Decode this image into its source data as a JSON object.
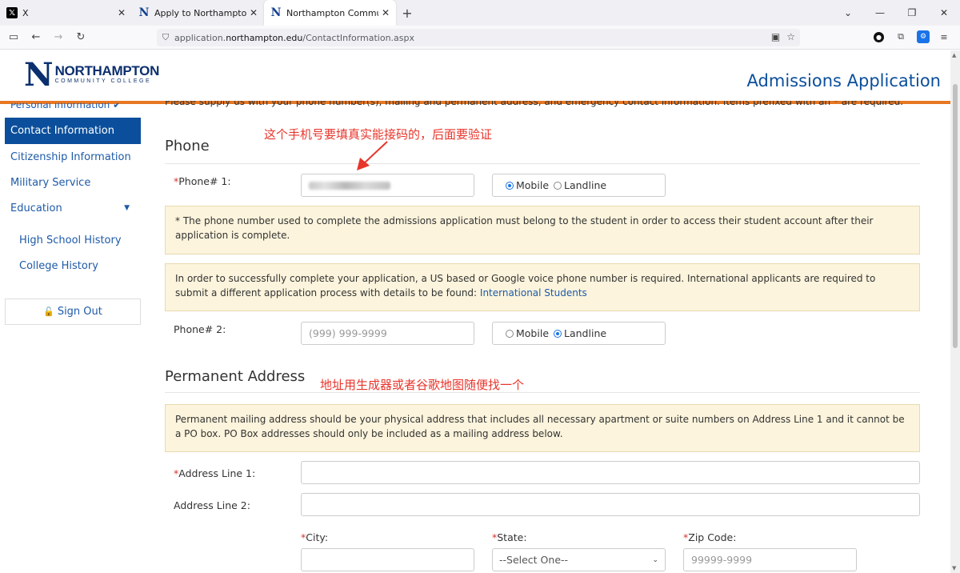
{
  "browser": {
    "tabs": [
      {
        "title": "X",
        "favicon": "x-logo"
      },
      {
        "title": "Apply to Northampton Community College",
        "favicon": "n-logo"
      },
      {
        "title": "Northampton Community College",
        "favicon": "n-logo"
      }
    ],
    "url_prefix": "application.",
    "url_domain": "northampton.edu",
    "url_path": "/ContactInformation.aspx"
  },
  "header": {
    "logo_letter": "N",
    "logo_line1": "NORTHAMPTON",
    "logo_line2": "COMMUNITY COLLEGE",
    "app_title": "Admissions Application"
  },
  "sidebar": {
    "partial_item": "Personal Information",
    "items": [
      {
        "label": "Contact Information",
        "active": true
      },
      {
        "label": "Citizenship Information"
      },
      {
        "label": "Military Service"
      },
      {
        "label": "Education"
      }
    ],
    "sub_items": [
      {
        "label": "High School History"
      },
      {
        "label": "College History"
      }
    ],
    "sign_out": "Sign Out"
  },
  "main": {
    "intro": "Please supply us with your phone number(s), mailing and permanent address, and emergency contact information. Items prefixed with an * are required.",
    "phone_section": {
      "title": "Phone",
      "phone1_label": "Phone# 1:",
      "phone1_type_mobile": "Mobile",
      "phone1_type_landline": "Landline",
      "phone1_selected": "Mobile",
      "notice1": "* The phone number used to complete the admissions application must belong to the student in order to access their student account after their application is complete.",
      "notice2_text": "In order to successfully complete your application, a US based or Google voice phone number is required. International applicants are required to submit a different application process with details to be found: ",
      "notice2_link": "International Students",
      "phone2_label": "Phone# 2:",
      "phone2_placeholder": "(999) 999-9999",
      "phone2_type_mobile": "Mobile",
      "phone2_type_landline": "Landline",
      "phone2_selected": "Landline"
    },
    "address_section": {
      "title": "Permanent Address",
      "notice": "Permanent mailing address should be your physical address that includes all necessary apartment or suite numbers on Address Line 1 and it cannot be a PO box.  PO Box addresses should only be included as a mailing address below.",
      "line1_label": "Address Line 1:",
      "line2_label": "Address Line 2:",
      "city_label": "City:",
      "state_label": "State:",
      "state_value": "--Select One--",
      "zip_label": "Zip Code:",
      "zip_placeholder": "99999-9999"
    }
  },
  "annotations": {
    "phone_note": "这个手机号要填真实能接码的，后面要验证",
    "address_note": "地址用生成器或者谷歌地图随便找一个"
  }
}
